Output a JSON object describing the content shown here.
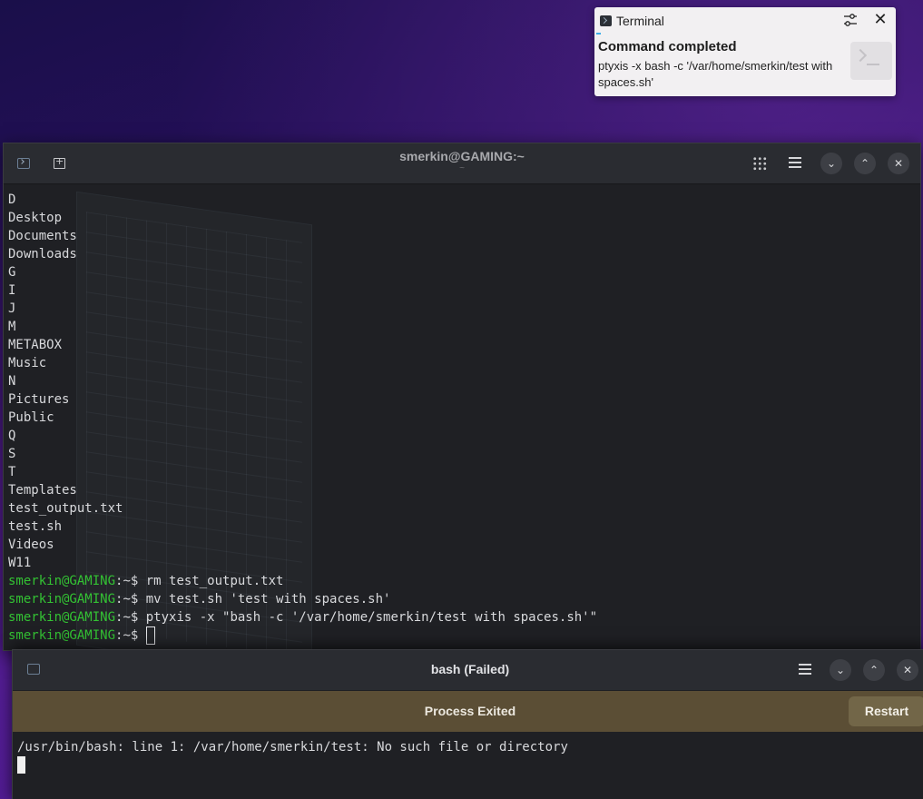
{
  "notification": {
    "app_name": "Terminal",
    "title": "Command completed",
    "body": "ptyxis -x bash -c '/var/home/smerkin/test with spaces.sh'",
    "close_glyph": "✕",
    "settings_icon": "settings-sliders-icon"
  },
  "main_window": {
    "title": "smerkin@GAMING:~",
    "subtitle": "~",
    "buttons": {
      "minimize_glyph": "⌄",
      "maximize_glyph": "⌃",
      "close_glyph": "✕"
    },
    "output_lines": [
      "D",
      "Desktop",
      "Documents",
      "Downloads",
      "G",
      "I",
      "J",
      "M",
      "METABOX",
      "Music",
      "N",
      "Pictures",
      "Public",
      "Q",
      "S",
      "T",
      "Templates",
      "test_output.txt",
      "test.sh",
      "Videos",
      "W11"
    ],
    "commands": [
      {
        "prompt": "smerkin@GAMING",
        "suffix": ":~$ ",
        "command": "rm test_output.txt"
      },
      {
        "prompt": "smerkin@GAMING",
        "suffix": ":~$ ",
        "command": "mv test.sh 'test with spaces.sh'"
      },
      {
        "prompt": "smerkin@GAMING",
        "suffix": ":~$ ",
        "command": "ptyxis -x \"bash -c '/var/home/smerkin/test with spaces.sh'\""
      },
      {
        "prompt": "smerkin@GAMING",
        "suffix": ":~$ ",
        "command": ""
      }
    ]
  },
  "bash_window": {
    "title": "bash (Failed)",
    "banner_text": "Process Exited",
    "restart_label": "Restart",
    "error_line": "/usr/bin/bash: line 1: /var/home/smerkin/test: No such file or directory",
    "buttons": {
      "minimize_glyph": "⌄",
      "maximize_glyph": "⌃",
      "close_glyph": "✕"
    }
  },
  "colors": {
    "prompt_green": "#33c233",
    "banner_brown": "#5b4e35",
    "restart_button": "#726648",
    "terminal_bg": "#1f2024",
    "header_bg": "#2a2c31"
  }
}
